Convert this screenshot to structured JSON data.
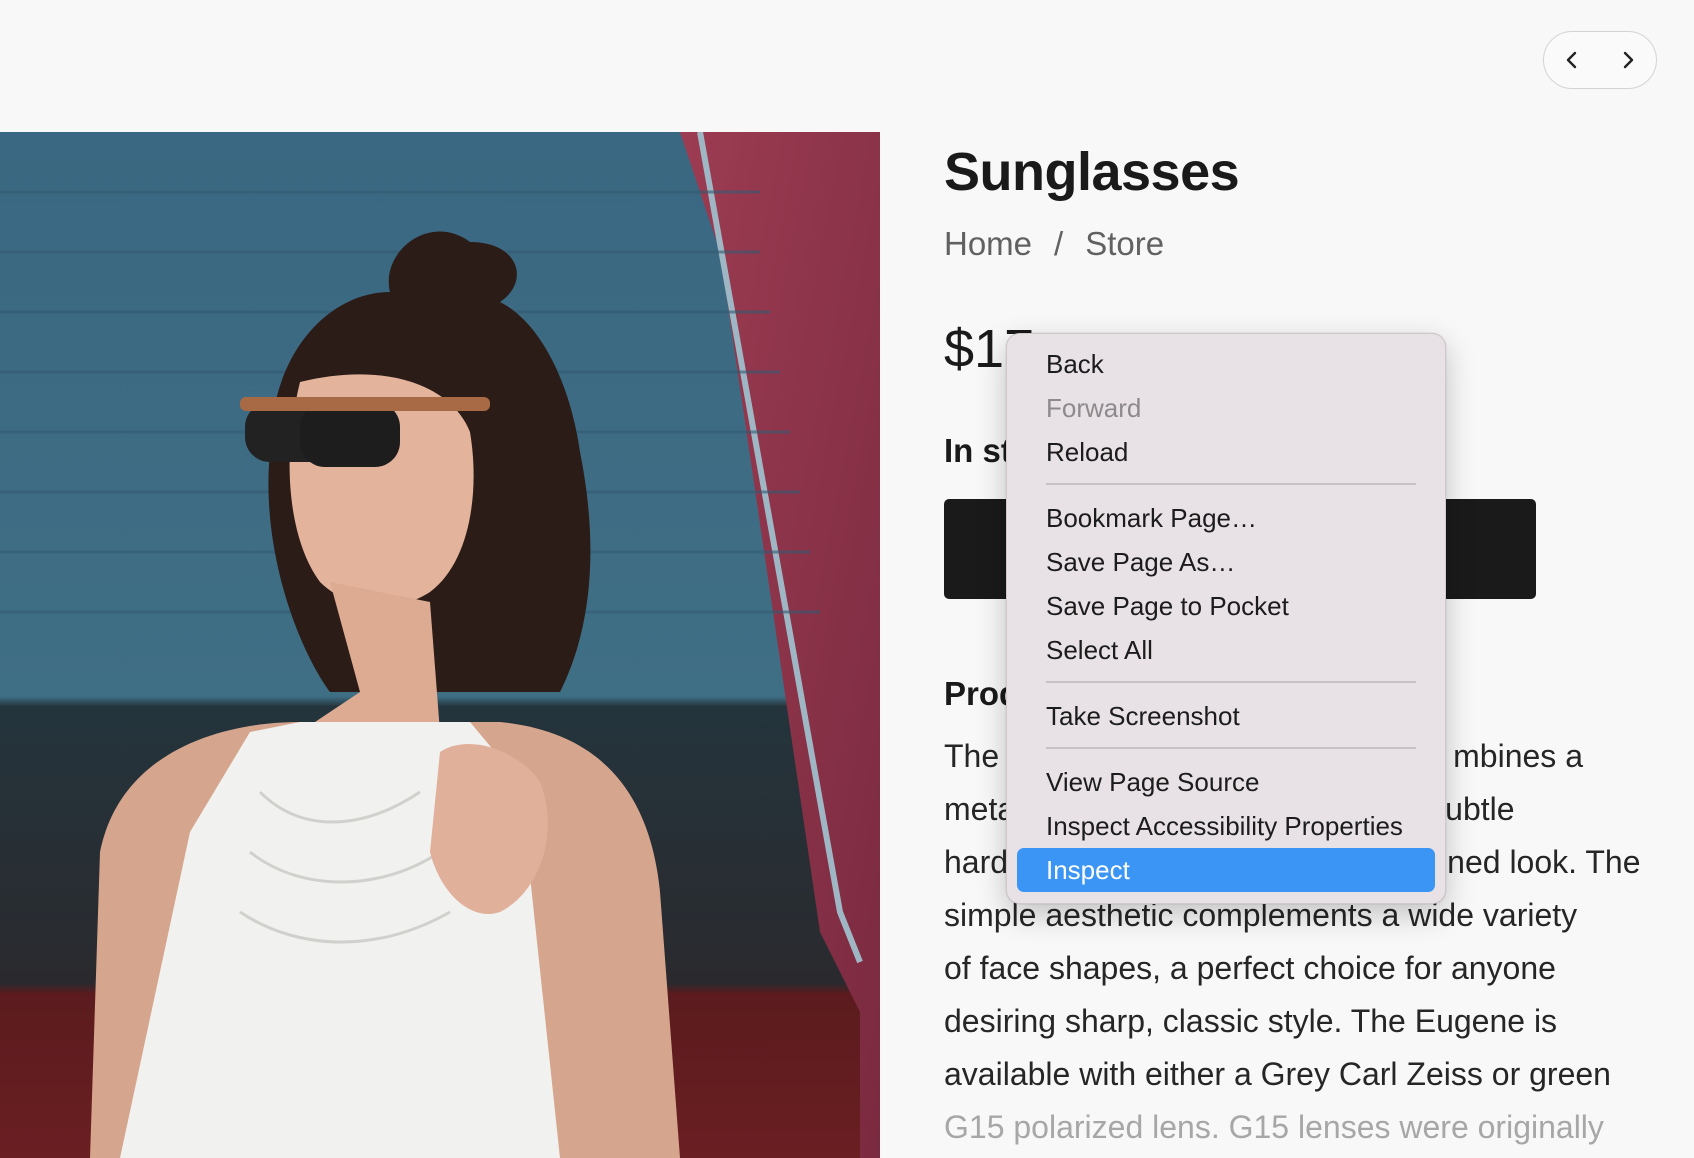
{
  "nav": {
    "back_icon": "chevron-left-icon",
    "forward_icon": "chevron-right-icon"
  },
  "product": {
    "title": "Sunglasses",
    "breadcrumb": [
      "Home",
      "/",
      "Store"
    ],
    "price_visible": "$17",
    "stock_visible": "In st",
    "description_heading_visible": "Prod",
    "description_lines": [
      [
        "The",
        "mbines a"
      ],
      [
        "meta",
        "ubtle"
      ],
      [
        "hard",
        "ined look. The"
      ],
      [
        "simple aesthetic complements a wide variety"
      ],
      [
        "of face shapes, a perfect choice for anyone"
      ],
      [
        "desiring sharp, classic style. The Eugene is"
      ],
      [
        "available with either a Grey Carl Zeiss or green"
      ],
      [
        "G15 polarized lens. G15 lenses were originally"
      ]
    ]
  },
  "context_menu": {
    "groups": [
      [
        {
          "label": "Back",
          "state": "normal"
        },
        {
          "label": "Forward",
          "state": "disabled"
        },
        {
          "label": "Reload",
          "state": "normal"
        }
      ],
      [
        {
          "label": "Bookmark Page…",
          "state": "normal"
        },
        {
          "label": "Save Page As…",
          "state": "normal"
        },
        {
          "label": "Save Page to Pocket",
          "state": "normal"
        },
        {
          "label": "Select All",
          "state": "normal"
        }
      ],
      [
        {
          "label": "Take Screenshot",
          "state": "normal"
        }
      ],
      [
        {
          "label": "View Page Source",
          "state": "normal"
        },
        {
          "label": "Inspect Accessibility Properties",
          "state": "normal"
        },
        {
          "label": "Inspect",
          "state": "highlighted"
        }
      ]
    ]
  },
  "colors": {
    "background": "#f8f8f8",
    "cta": "#1a1a1a",
    "menu_bg": "#e8e2e6",
    "menu_highlight": "#3a95f5"
  }
}
